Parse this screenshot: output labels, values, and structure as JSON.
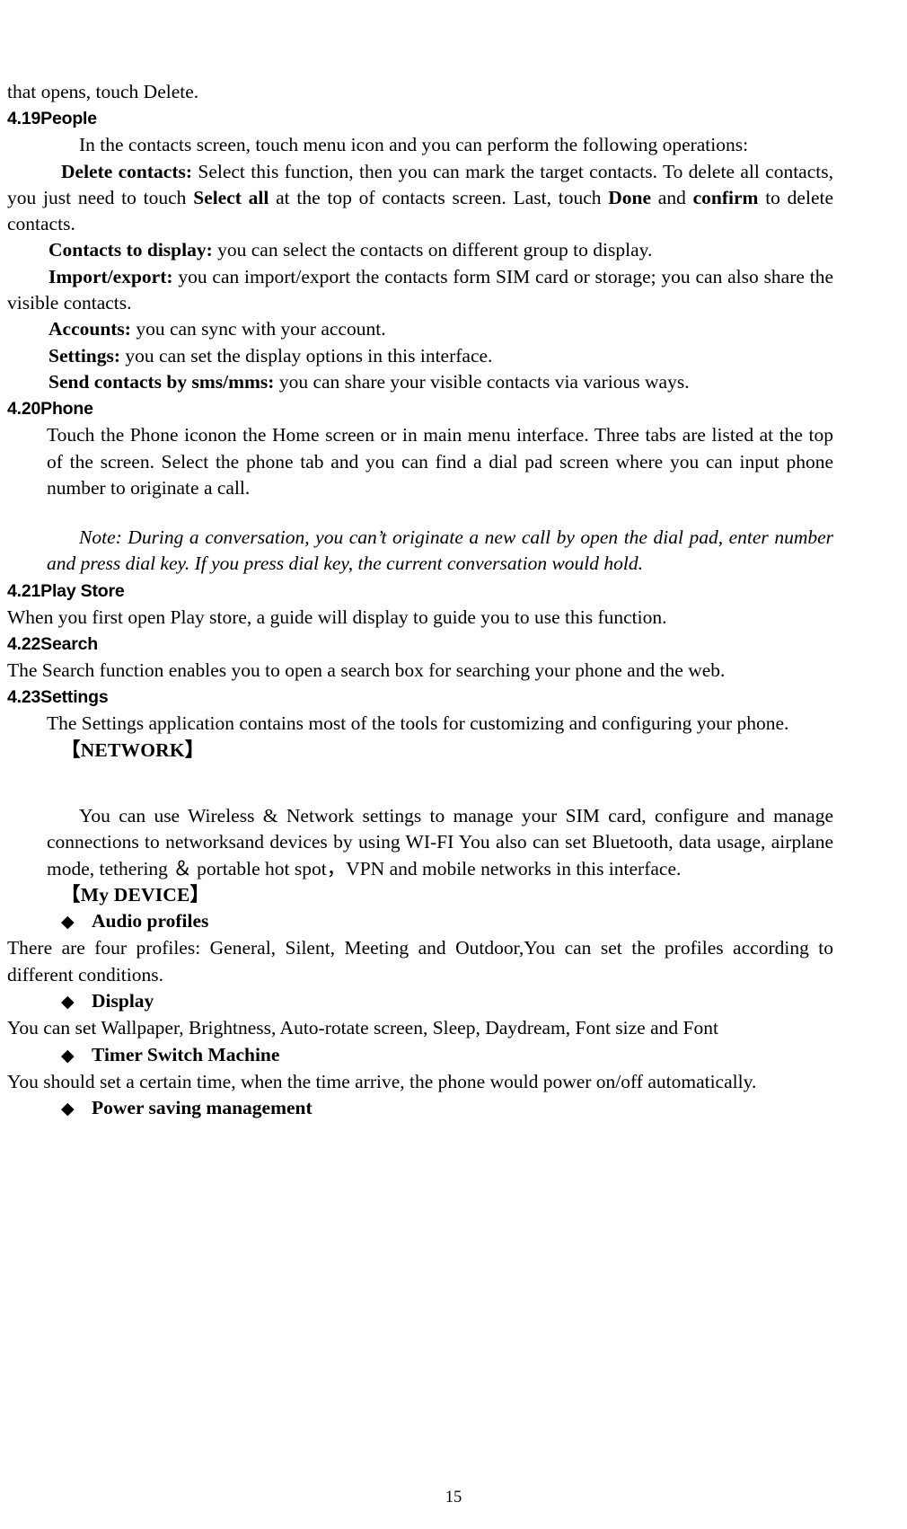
{
  "document": {
    "page_number": "15",
    "lead_paragraph": "that opens, touch Delete."
  },
  "sections": [
    {
      "id": "people",
      "heading": "4.19People",
      "intro": "In the contacts screen, touch menu icon and you can perform the following operations:",
      "items": [
        {
          "term": "Delete contacts:",
          "text_1": " Select this function, then you can mark the target contacts. To delete all contacts, you just need to touch ",
          "strong_1": "Select all",
          "text_2": " at the top of contacts screen. Last, touch ",
          "strong_2": "Done",
          "text_3": " and ",
          "strong_3": "confirm",
          "text_4": " to delete contacts."
        },
        {
          "term": "Contacts to display:",
          "text": " you can select the contacts on different group to display."
        },
        {
          "term": "Import/export:",
          "text": " you can import/export the contacts form SIM card or storage; you can also share the visible contacts."
        },
        {
          "term": "Accounts:",
          "text": " you can sync with your account."
        },
        {
          "term": "Settings:",
          "text": " you can set the display options in this interface."
        },
        {
          "term": "Send contacts by sms/mms:",
          "text": " you can share your visible contacts via various ways."
        }
      ]
    },
    {
      "id": "phone",
      "heading": "4.20Phone",
      "paragraph": "Touch the Phone iconon the Home screen or in main menu interface. Three tabs are listed at the top of the screen. Select the phone tab and you can find a dial pad screen where you can input phone number to originate a call.",
      "note": "Note: During a conversation, you can’t originate a new call by open the dial pad, enter number and press dial key. If you press dial key, the current conversation would hold."
    },
    {
      "id": "play-store",
      "heading": "4.21Play Store",
      "paragraph": "When you first open  Play store, a guide will display to guide you to use this function."
    },
    {
      "id": "search",
      "heading": "4.22Search",
      "paragraph": "The Search function enables you to open a search box for searching your phone and the web."
    },
    {
      "id": "settings",
      "heading": "4.23Settings",
      "paragraph": "The Settings application contains most of the tools for customizing and configuring your phone.",
      "groups": [
        {
          "title": "【NETWORK】",
          "paragraph": "You can use Wireless & Network settings to manage your SIM card, configure and manage connections to networksand devices by using WI-FI You also can set Bluetooth, data usage, airplane mode, tethering ＆ portable hot spot，VPN and mobile networks in this interface."
        },
        {
          "title": "【My DEVICE】",
          "bullets": [
            {
              "marker": "◆",
              "label": "Audio profiles",
              "body": "There are four profiles: General, Silent, Meeting and Outdoor,You can set the profiles according to different conditions."
            },
            {
              "marker": "◆",
              "label": "Display",
              "body": "You can set Wallpaper, Brightness, Auto-rotate screen, Sleep, Daydream, Font size and Font"
            },
            {
              "marker": "◆",
              "label": "Timer Switch Machine",
              "body": "You should set a certain time, when the time arrive, the phone would power on/off automatically."
            },
            {
              "marker": "◆",
              "label": "Power saving management",
              "body": ""
            }
          ]
        }
      ]
    }
  ]
}
